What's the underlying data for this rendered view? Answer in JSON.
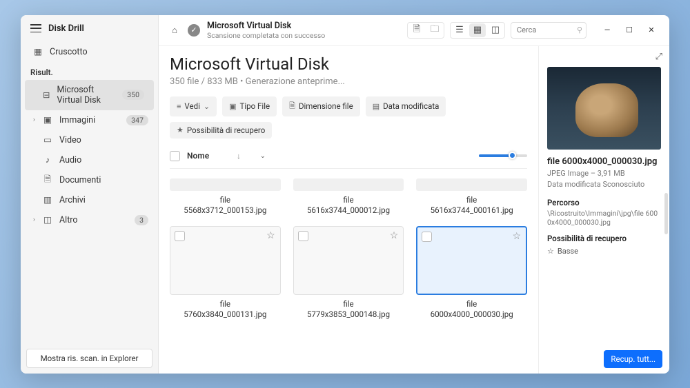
{
  "app": {
    "title": "Disk Drill"
  },
  "sidebar": {
    "cruscotto": "Cruscotto",
    "section_results": "Risult.",
    "items": {
      "mvd": {
        "label": "Microsoft Virtual Disk",
        "badge": "350"
      },
      "immagini": {
        "label": "Immagini",
        "badge": "347"
      },
      "video": {
        "label": "Video"
      },
      "audio": {
        "label": "Audio"
      },
      "documenti": {
        "label": "Documenti"
      },
      "archivi": {
        "label": "Archivi"
      },
      "altro": {
        "label": "Altro",
        "badge": "3"
      }
    },
    "footer_btn": "Mostra ris. scan. in Explorer"
  },
  "topbar": {
    "title": "Microsoft Virtual Disk",
    "subtitle": "Scansione completata con successo",
    "search_placeholder": "Cerca"
  },
  "page": {
    "title": "Microsoft Virtual Disk",
    "subtitle": "350 file / 833 MB • Generazione anteprime..."
  },
  "filters": {
    "vedi": "Vedi",
    "tipo": "Tipo File",
    "dim": "Dimensione file",
    "data": "Data modificata",
    "recup": "Possibilità di recupero"
  },
  "list_header": {
    "name_col": "Nome"
  },
  "files": [
    {
      "line1": "file",
      "line2": "5568x3712_000153.jpg"
    },
    {
      "line1": "file",
      "line2": "5616x3744_000012.jpg"
    },
    {
      "line1": "file",
      "line2": "5616x3744_000161.jpg"
    },
    {
      "line1": "file",
      "line2": "5760x3840_000131.jpg"
    },
    {
      "line1": "file",
      "line2": "5779x3853_000148.jpg"
    },
    {
      "line1": "file",
      "line2": "6000x4000_000030.jpg"
    }
  ],
  "detail": {
    "title": "file 6000x4000_000030.jpg",
    "meta1": "JPEG Image – 3,91 MB",
    "meta2": "Data modificata Sconosciuto",
    "path_label": "Percorso",
    "path_value": "\\Ricostruito\\Immagini\\jpg\\file 6000x4000_000030.jpg",
    "recov_label": "Possibilità di recupero",
    "recov_value": "Basse",
    "recover_btn": "Recup. tutt..."
  }
}
